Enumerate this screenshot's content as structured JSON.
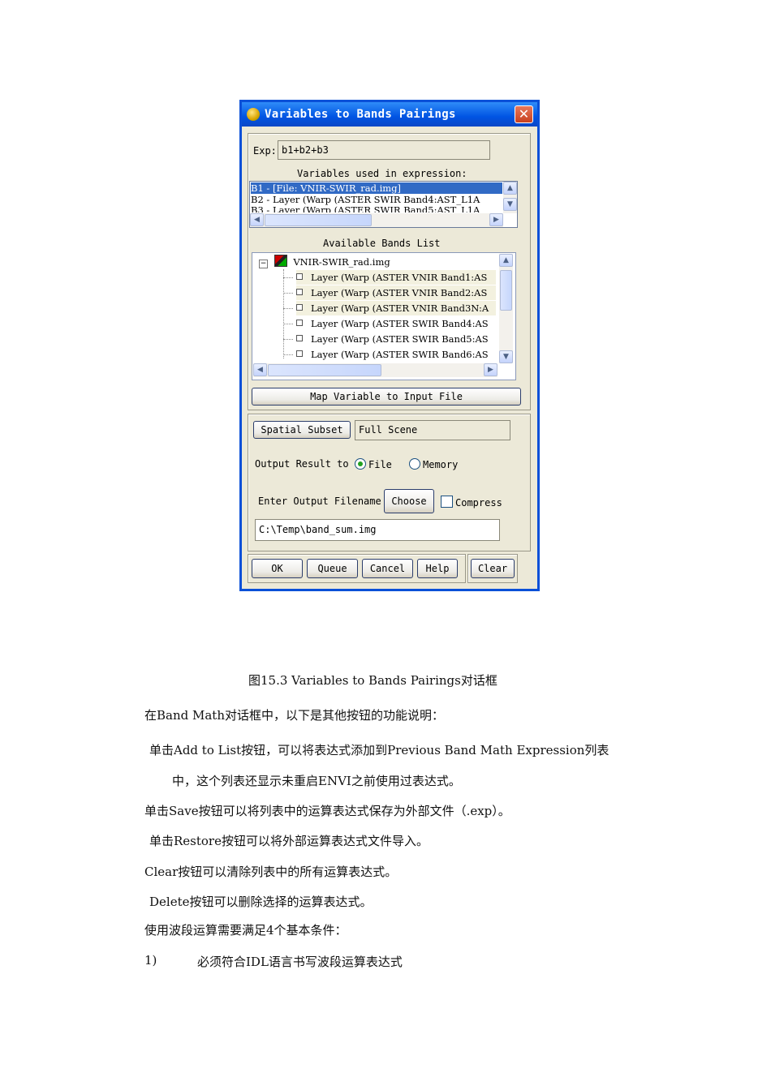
{
  "dialog": {
    "title": "Variables to Bands Pairings",
    "close_label": "✕",
    "exp_label": "Exp:",
    "exp_value": "b1+b2+b3",
    "variables_heading": "Variables used in expression:",
    "variables": [
      "B1 - [File: VNIR-SWIR_rad.img]",
      "B2 - Layer (Warp (ASTER SWIR Band4:AST_L1A",
      "B3 - Layer (Warp (ASTER SWIR Band5:AST_L1A"
    ],
    "bands_heading": "Available Bands List",
    "bands_file": "VNIR-SWIR_rad.img",
    "bands": [
      "Layer (Warp (ASTER VNIR Band1:AS",
      "Layer (Warp (ASTER VNIR Band2:AS",
      "Layer (Warp (ASTER VNIR Band3N:A",
      "Layer (Warp (ASTER SWIR Band4:AS",
      "Layer (Warp (ASTER SWIR Band5:AS",
      "Layer (Warp (ASTER SWIR Band6:AS"
    ],
    "map_button": "Map Variable to Input File",
    "spatial_subset_button": "Spatial Subset",
    "spatial_subset_value": "Full Scene",
    "output_label": "Output Result to",
    "output_options": [
      "File",
      "Memory"
    ],
    "output_selected": "File",
    "filename_label": "Enter Output Filename",
    "choose_button": "Choose",
    "compress_label": "Compress",
    "filename_value": "C:\\Temp\\band_sum.img",
    "buttons": {
      "ok": "OK",
      "queue": "Queue",
      "cancel": "Cancel",
      "help": "Help",
      "clear": "Clear"
    }
  },
  "document": {
    "caption": "图15.3 Variables to Bands Pairings对话框",
    "paragraphs": [
      "在Band Math对话框中，以下是其他按钮的功能说明：",
      "单击Add to List按钮，可以将表达式添加到Previous Band Math Expression列表",
      "中，这个列表还显示未重启ENVI之前使用过表达式。",
      "单击Save按钮可以将列表中的运算表达式保存为外部文件（.exp）。",
      "单击Restore按钮可以将外部运算表达式文件导入。",
      "Clear按钮可以清除列表中的所有运算表达式。",
      "Delete按钮可以删除选择的运算表达式。",
      "使用波段运算需要满足4个基本条件："
    ],
    "list_item": {
      "number": "1)",
      "text": "必须符合IDL语言书写波段运算表达式"
    }
  }
}
